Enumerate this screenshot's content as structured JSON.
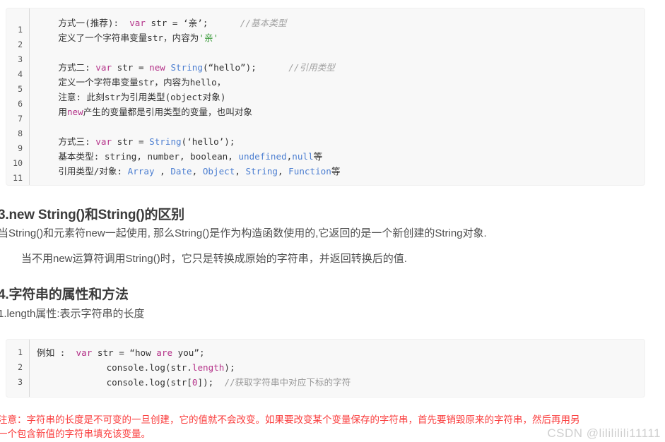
{
  "code_block_1": {
    "line_numbers": [
      "1",
      "2",
      "3",
      "4",
      "5",
      "6",
      "7",
      "8",
      "9",
      "10",
      "11"
    ],
    "lines": [
      {
        "n": "1",
        "segments": [
          {
            "t": "    方式一(推荐):  ",
            "c": "plain"
          },
          {
            "t": "var",
            "c": "kw"
          },
          {
            "t": " str = ",
            "c": "plain"
          },
          {
            "t": "‘亲’",
            "c": "plain"
          },
          {
            "t": ";      ",
            "c": "plain"
          },
          {
            "t": "//基本类型",
            "c": "cmt"
          }
        ]
      },
      {
        "n": "2",
        "segments": [
          {
            "t": "    定义了一个字符串变量str，内容为",
            "c": "plain"
          },
          {
            "t": "'亲'",
            "c": "str"
          }
        ]
      },
      {
        "n": "3",
        "segments": [
          {
            "t": "",
            "c": "plain"
          }
        ]
      },
      {
        "n": "4",
        "segments": [
          {
            "t": "    方式二: ",
            "c": "plain"
          },
          {
            "t": "var",
            "c": "kw"
          },
          {
            "t": " str = ",
            "c": "plain"
          },
          {
            "t": "new",
            "c": "kw"
          },
          {
            "t": " ",
            "c": "plain"
          },
          {
            "t": "String",
            "c": "type"
          },
          {
            "t": "(“hello”);      ",
            "c": "plain"
          },
          {
            "t": "//引用类型",
            "c": "cmt"
          }
        ]
      },
      {
        "n": "5",
        "segments": [
          {
            "t": "    定义一个字符串变量str，内容为hello，",
            "c": "plain"
          }
        ]
      },
      {
        "n": "6",
        "segments": [
          {
            "t": "    注意: 此刻str为引用类型(object对象)",
            "c": "plain"
          }
        ]
      },
      {
        "n": "7",
        "segments": [
          {
            "t": "    用",
            "c": "plain"
          },
          {
            "t": "new",
            "c": "kw"
          },
          {
            "t": "产生的变量都是引用类型的变量，也叫对象",
            "c": "plain"
          }
        ]
      },
      {
        "n": "8",
        "segments": [
          {
            "t": "",
            "c": "plain"
          }
        ]
      },
      {
        "n": "9",
        "segments": [
          {
            "t": "    方式三: ",
            "c": "plain"
          },
          {
            "t": "var",
            "c": "kw"
          },
          {
            "t": " str = ",
            "c": "plain"
          },
          {
            "t": "String",
            "c": "type"
          },
          {
            "t": "(‘hello’);",
            "c": "plain"
          }
        ]
      },
      {
        "n": "10",
        "segments": [
          {
            "t": "    基本类型: string, number, boolean, ",
            "c": "plain"
          },
          {
            "t": "undefined",
            "c": "type"
          },
          {
            "t": ",",
            "c": "plain"
          },
          {
            "t": "null",
            "c": "type"
          },
          {
            "t": "等",
            "c": "plain"
          }
        ]
      },
      {
        "n": "11",
        "segments": [
          {
            "t": "    引用类型/对象: ",
            "c": "plain"
          },
          {
            "t": "Array",
            "c": "type"
          },
          {
            "t": " , ",
            "c": "plain"
          },
          {
            "t": "Date",
            "c": "type"
          },
          {
            "t": ", ",
            "c": "plain"
          },
          {
            "t": "Object",
            "c": "type"
          },
          {
            "t": ", ",
            "c": "plain"
          },
          {
            "t": "String",
            "c": "type"
          },
          {
            "t": ", ",
            "c": "plain"
          },
          {
            "t": "Function",
            "c": "type"
          },
          {
            "t": "等",
            "c": "plain"
          }
        ]
      }
    ]
  },
  "code_block_2": {
    "lines": [
      {
        "n": "1",
        "segments": [
          {
            "t": "例如 :  ",
            "c": "plain"
          },
          {
            "t": "var",
            "c": "kw"
          },
          {
            "t": " str = “how ",
            "c": "plain"
          },
          {
            "t": "are",
            "c": "kw"
          },
          {
            "t": " you”;",
            "c": "plain"
          }
        ]
      },
      {
        "n": "2",
        "segments": [
          {
            "t": "             console.log(str.",
            "c": "plain"
          },
          {
            "t": "length",
            "c": "kw"
          },
          {
            "t": ");",
            "c": "plain"
          }
        ]
      },
      {
        "n": "3",
        "segments": [
          {
            "t": "             console.log(str[",
            "c": "plain"
          },
          {
            "t": "0",
            "c": "kw"
          },
          {
            "t": "]);  ",
            "c": "plain"
          },
          {
            "t": "//获取字符串中对应下标的字符",
            "c": "cmt2"
          }
        ]
      }
    ]
  },
  "sections": {
    "heading_3": "3.new String()和String()的区别",
    "paragraph_3a": "当String()和元素符new一起使用, 那么String()是作为构造函数使用的,它返回的是一个新创建的String对象.",
    "paragraph_3b": "当不用new运算符调用String()时，它只是转换成原始的字符串，并返回转换后的值.",
    "heading_4": "4.字符串的属性和方法",
    "paragraph_4a": "1.length属性:表示字符串的长度"
  },
  "warning": {
    "line1": "注意：字符串的长度是不可变的一旦创建，它的值就不会改变。如果要改变某个变量保存的字符串，首先要销毁原来的字符串，然后再用另",
    "line2": "一个包含新值的字符串填充该变量。",
    "color": "#fa3c3c"
  },
  "watermark": {
    "text": "CSDN @lilililili11111"
  }
}
